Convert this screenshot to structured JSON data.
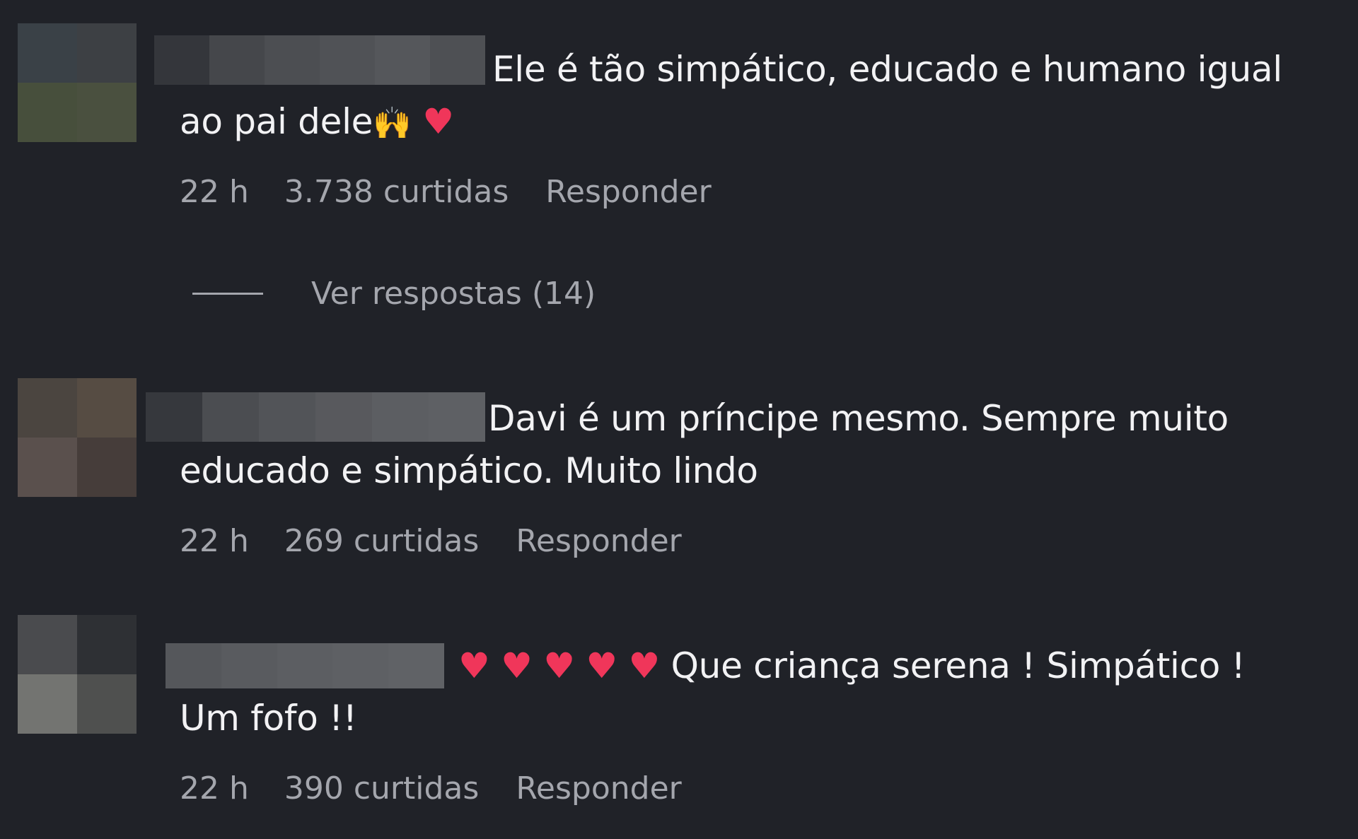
{
  "comments": [
    {
      "text_line1": "Ele é tão simpático, educado e humano igual",
      "text_line2": "ao pai dele",
      "emojis_inline": [
        "raising-hands",
        "heart"
      ],
      "time": "22 h",
      "likes": "3.738 curtidas",
      "reply_label": "Responder",
      "view_replies": "Ver respostas (14)"
    },
    {
      "text_line1": "Davi é um príncipe mesmo. Sempre muito",
      "text_line2": "educado e simpático. Muito lindo",
      "time": "22 h",
      "likes": "269 curtidas",
      "reply_label": "Responder"
    },
    {
      "text_line1": "Que criança serena ! Simpático !",
      "text_line2": "Um fofo !!",
      "emojis_leading": [
        "heart",
        "heart",
        "heart",
        "heart",
        "heart"
      ],
      "time": "22 h",
      "likes": "390 curtidas",
      "reply_label": "Responder"
    }
  ],
  "colors": {
    "background": "#202228",
    "text": "#f2f2f4",
    "meta_text": "#a4a6ad",
    "heart": "#f0365a",
    "hands": "#f5b722"
  }
}
